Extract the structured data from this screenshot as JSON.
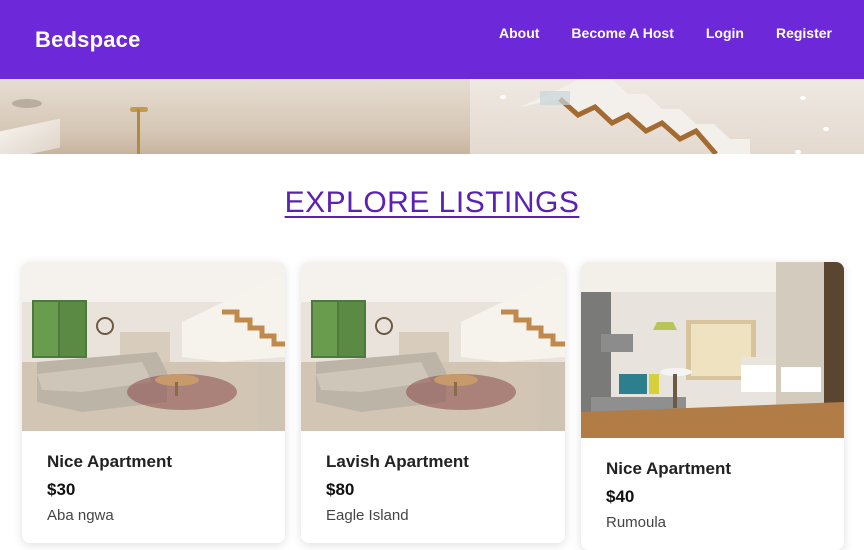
{
  "brand": "Bedspace",
  "nav": {
    "items": [
      {
        "label": "About"
      },
      {
        "label": "Become A Host"
      },
      {
        "label": "Login"
      },
      {
        "label": "Register"
      }
    ]
  },
  "main": {
    "title": "EXPLORE LISTINGS",
    "listings": [
      {
        "title": "Nice Apartment",
        "price": "$30",
        "location": "Aba ngwa",
        "image": "living-room-staircase-photo"
      },
      {
        "title": "Lavish Apartment",
        "price": "$80",
        "location": "Eagle Island",
        "image": "living-room-staircase-photo"
      },
      {
        "title": "Nice Apartment",
        "price": "$40",
        "location": "Rumoula",
        "image": "hotel-bedroom-photo"
      }
    ]
  },
  "colors": {
    "brand_purple": "#6d28d9",
    "title_purple": "#5b21b6"
  }
}
